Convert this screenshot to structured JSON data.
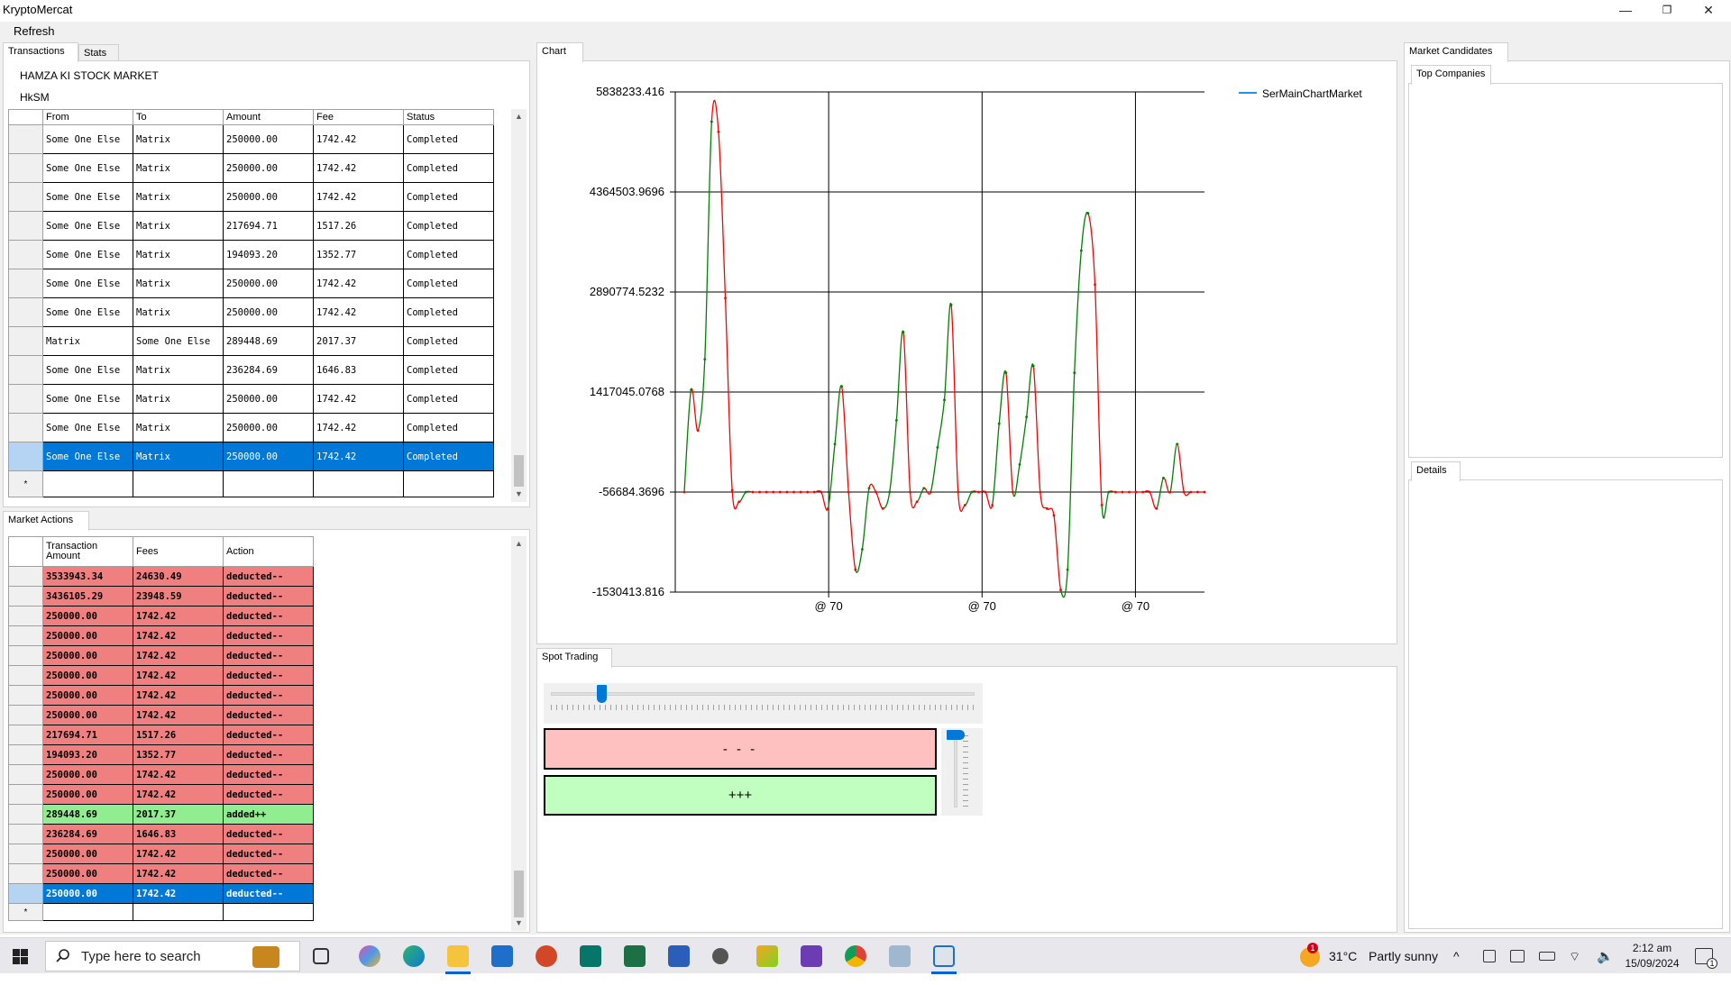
{
  "window": {
    "title": "KryptoMercat",
    "minimize": "—",
    "restore": "❐",
    "close": "✕"
  },
  "menu": {
    "refresh": "Refresh"
  },
  "tabs_left": {
    "transactions": "Transactions",
    "stats": "Stats"
  },
  "market": {
    "name": "HAMZA KI STOCK MARKET",
    "symbol": "HkSM"
  },
  "transactions": {
    "columns": [
      "From",
      "To",
      "Amount",
      "Fee",
      "Status"
    ],
    "rows": [
      [
        "Some One Else",
        "Matrix",
        "250000.00",
        "1742.42",
        "Completed"
      ],
      [
        "Some One Else",
        "Matrix",
        "250000.00",
        "1742.42",
        "Completed"
      ],
      [
        "Some One Else",
        "Matrix",
        "250000.00",
        "1742.42",
        "Completed"
      ],
      [
        "Some One Else",
        "Matrix",
        "217694.71",
        "1517.26",
        "Completed"
      ],
      [
        "Some One Else",
        "Matrix",
        "194093.20",
        "1352.77",
        "Completed"
      ],
      [
        "Some One Else",
        "Matrix",
        "250000.00",
        "1742.42",
        "Completed"
      ],
      [
        "Some One Else",
        "Matrix",
        "250000.00",
        "1742.42",
        "Completed"
      ],
      [
        "Matrix",
        "Some One Else",
        "289448.69",
        "2017.37",
        "Completed"
      ],
      [
        "Some One Else",
        "Matrix",
        "236284.69",
        "1646.83",
        "Completed"
      ],
      [
        "Some One Else",
        "Matrix",
        "250000.00",
        "1742.42",
        "Completed"
      ],
      [
        "Some One Else",
        "Matrix",
        "250000.00",
        "1742.42",
        "Completed"
      ],
      [
        "Some One Else",
        "Matrix",
        "250000.00",
        "1742.42",
        "Completed"
      ]
    ],
    "selected_index": 11,
    "new_row_marker": "*"
  },
  "market_actions": {
    "tab": "Market Actions",
    "columns": [
      "Transaction Amount",
      "Fees",
      "Action"
    ],
    "rows": [
      [
        "3533943.34",
        "24630.49",
        "deducted--"
      ],
      [
        "3436105.29",
        "23948.59",
        "deducted--"
      ],
      [
        "250000.00",
        "1742.42",
        "deducted--"
      ],
      [
        "250000.00",
        "1742.42",
        "deducted--"
      ],
      [
        "250000.00",
        "1742.42",
        "deducted--"
      ],
      [
        "250000.00",
        "1742.42",
        "deducted--"
      ],
      [
        "250000.00",
        "1742.42",
        "deducted--"
      ],
      [
        "250000.00",
        "1742.42",
        "deducted--"
      ],
      [
        "217694.71",
        "1517.26",
        "deducted--"
      ],
      [
        "194093.20",
        "1352.77",
        "deducted--"
      ],
      [
        "250000.00",
        "1742.42",
        "deducted--"
      ],
      [
        "250000.00",
        "1742.42",
        "deducted--"
      ],
      [
        "289448.69",
        "2017.37",
        "added++"
      ],
      [
        "236284.69",
        "1646.83",
        "deducted--"
      ],
      [
        "250000.00",
        "1742.42",
        "deducted--"
      ],
      [
        "250000.00",
        "1742.42",
        "deducted--"
      ],
      [
        "250000.00",
        "1742.42",
        "deducted--"
      ]
    ],
    "selected_index": 16,
    "new_row_marker": "*"
  },
  "chart_tab": "Chart",
  "chart_data": {
    "type": "line",
    "title": "",
    "legend": {
      "entries": [
        "SerMainChartMarket"
      ],
      "placement": "top-right"
    },
    "y_ticks": [
      "5838233.416",
      "4364503.9696",
      "2890774.5232",
      "1417045.0768",
      "-56684.3696",
      "-1530413.816"
    ],
    "ylim": [
      -1530413.816,
      5838233.416
    ],
    "x_ticks": [
      "@ 70",
      "@ 70",
      "@ 70"
    ],
    "grid": true,
    "colors": {
      "rising": "#008000",
      "falling": "#ff0000",
      "legend_line": "#1e90ff"
    },
    "values": [
      -56684,
      1450000,
      850000,
      1900000,
      5400000,
      5250000,
      2800000,
      -30000,
      -200000,
      -56684,
      -56684,
      -56684,
      -56684,
      -56684,
      -56684,
      -56684,
      -56684,
      -56684,
      -56684,
      -56684,
      -56684,
      -300000,
      650000,
      1500000,
      -56684,
      -1200000,
      -900000,
      0,
      -56684,
      -300000,
      -56684,
      1000000,
      2300000,
      -56684,
      -200000,
      0,
      -56684,
      600000,
      1300000,
      2700000,
      -56684,
      -250000,
      -56684,
      -56684,
      -56684,
      -250000,
      950000,
      1700000,
      -56684,
      350000,
      1050000,
      1800000,
      -56684,
      -300000,
      -400000,
      -1500000,
      -1200000,
      1700000,
      3500000,
      4050000,
      3000000,
      -250000,
      -56684,
      -56684,
      -56684,
      -56684,
      -56684,
      -56684,
      -56684,
      -300000,
      150000,
      -56684,
      650000,
      -56684,
      -56684,
      -56684,
      -56684
    ]
  },
  "candidates": {
    "tab": "Market Candidates",
    "top_companies": "Top Companies",
    "details": "Details"
  },
  "spot": {
    "tab": "Spot Trading",
    "minus": "- - -",
    "plus": "+++",
    "h_slider_level": 0.11,
    "v_slider_level": 0.0
  },
  "taskbar": {
    "search_placeholder": "Type here to search",
    "temperature": "31°C",
    "weather": "Partly sunny",
    "time": "2:12 am",
    "date": "15/09/2024",
    "weather_badge": "1",
    "notification_count": "1"
  }
}
